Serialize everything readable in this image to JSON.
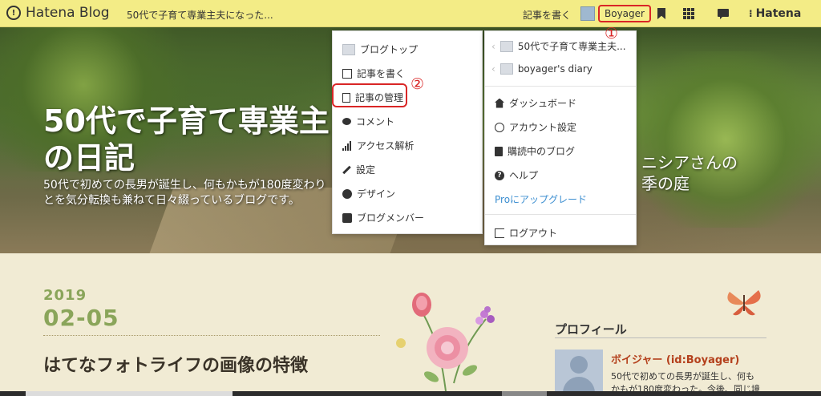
{
  "topbar": {
    "brand": "Hatena Blog",
    "blog_title": "50代で子育て専業主夫になった...",
    "write_link": "記事を書く",
    "username": "Boyager",
    "hatena": "Hatena",
    "icons": [
      "bookmark-icon",
      "apps-grid-icon",
      "notification-icon",
      "hatena-logo-icon"
    ]
  },
  "hero": {
    "title": "50代で子育て専業主\nの日記",
    "description": "50代で初めての長男が誕生し、何もかもが180度変わり\nとを気分転換も兼ねて日々綴っているブログです。",
    "right_text": "ニシアさんの\n季の庭"
  },
  "blog_menu": {
    "items": [
      {
        "label": "ブログトップ",
        "icon": "blog-thumbnail-icon"
      },
      {
        "label": "記事を書く",
        "icon": "edit-icon"
      },
      {
        "label": "記事の管理",
        "icon": "document-icon"
      },
      {
        "label": "コメント",
        "icon": "comment-icon"
      },
      {
        "label": "アクセス解析",
        "icon": "bar-chart-icon"
      },
      {
        "label": "設定",
        "icon": "wrench-icon"
      },
      {
        "label": "デザイン",
        "icon": "palette-icon"
      },
      {
        "label": "ブログメンバー",
        "icon": "member-icon"
      }
    ]
  },
  "account_menu": {
    "blogs": [
      {
        "label": "50代で子育て専業主夫..."
      },
      {
        "label": "boyager's diary"
      }
    ],
    "items": [
      {
        "label": "ダッシュボード",
        "icon": "home-icon"
      },
      {
        "label": "アカウント設定",
        "icon": "user-icon"
      },
      {
        "label": "購読中のブログ",
        "icon": "book-icon"
      },
      {
        "label": "ヘルプ",
        "icon": "help-icon"
      },
      {
        "label": "Proにアップグレード",
        "icon": ""
      }
    ],
    "logout": "ログアウト"
  },
  "annotations": {
    "marker_1": "①",
    "marker_2": "②",
    "color": "#d92626"
  },
  "article": {
    "year": "2019",
    "month_day": "02-05",
    "title": "はてなフォトライフの画像の特徴"
  },
  "sidebar": {
    "profile_heading": "プロフィール",
    "profile_name": "ボイジャー (id:Boyager)",
    "profile_desc": "50代で初めての長男が誕生し、何も\nかもが180度変わった。今後、同じ境"
  },
  "colors": {
    "topbar": "#f3ec86",
    "accent_green": "#8aa55a",
    "link_blue": "#3d8fd1"
  }
}
